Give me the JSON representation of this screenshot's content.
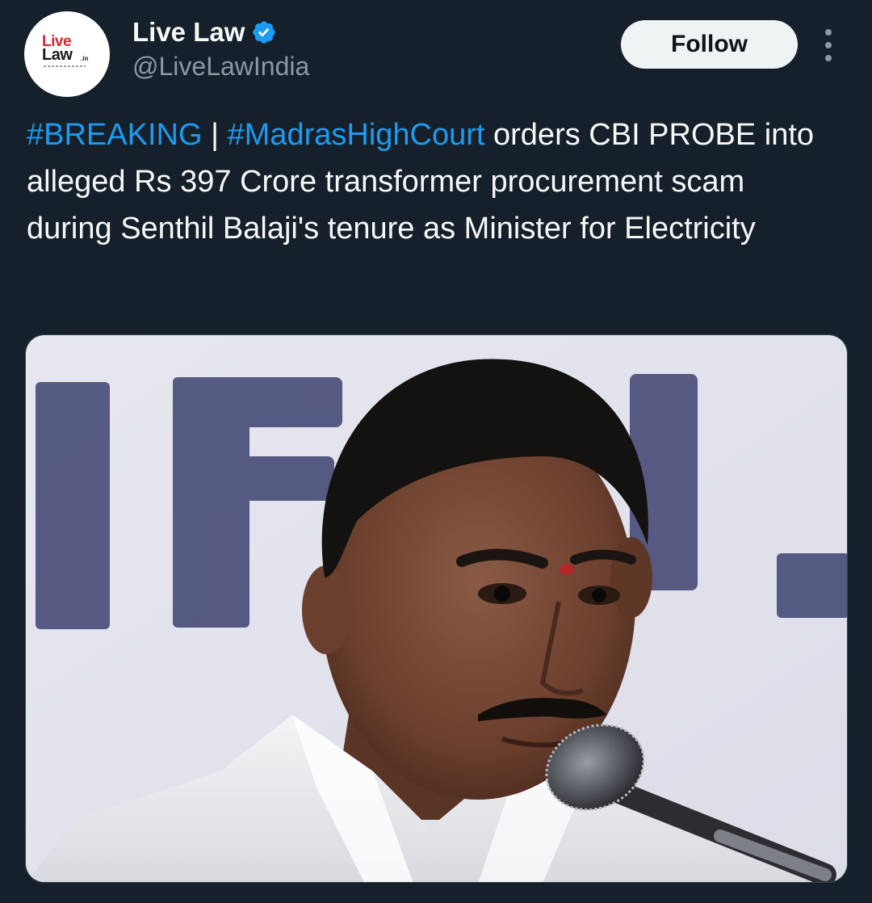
{
  "author": {
    "display_name": "Live Law",
    "handle": "@LiveLawIndia",
    "avatar_logo": {
      "line1": "Live",
      "line2": "Law",
      "suffix": ".in"
    },
    "verified_icon": "verified-badge-icon"
  },
  "actions": {
    "follow_label": "Follow",
    "more_icon": "more-vertical-icon"
  },
  "tweet": {
    "hashtag1": "#BREAKING",
    "separator": " | ",
    "hashtag2": "#MadrasHighCourt",
    "body": " orders CBI PROBE into alleged Rs 397 Crore transformer procurement scam during Senthil Balaji's tenure as Minister for Electricity"
  },
  "media": {
    "background_letters": "IRU."
  },
  "colors": {
    "background": "#15202b",
    "text": "#f7f9f9",
    "secondary_text": "#8b98a5",
    "link": "#1d9bf0",
    "verified": "#1d9bf0",
    "logo_red": "#d8262e"
  }
}
